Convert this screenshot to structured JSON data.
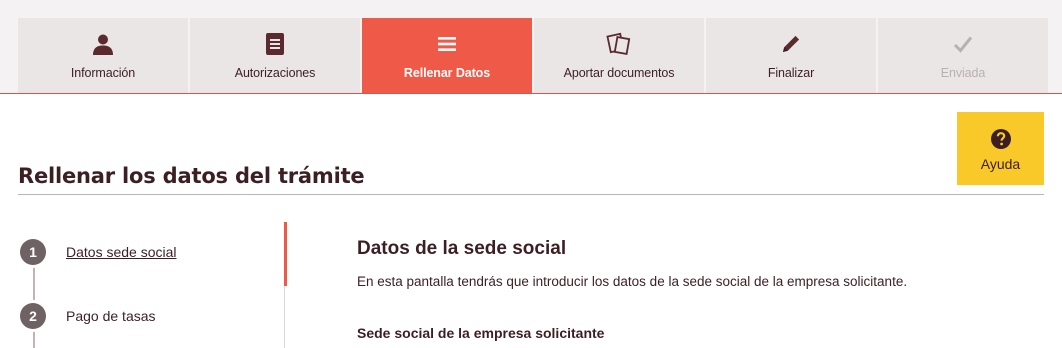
{
  "steps": [
    {
      "label": "Información",
      "icon": "user-icon",
      "state": "done"
    },
    {
      "label": "Autorizaciones",
      "icon": "document-icon",
      "state": "done"
    },
    {
      "label": "Rellenar Datos",
      "icon": "menu-lines-icon",
      "state": "active"
    },
    {
      "label": "Aportar documentos",
      "icon": "papers-icon",
      "state": "pending"
    },
    {
      "label": "Finalizar",
      "icon": "pencil-icon",
      "state": "pending"
    },
    {
      "label": "Enviada",
      "icon": "check-icon",
      "state": "disabled"
    }
  ],
  "help": {
    "label": "Ayuda",
    "icon": "question-circle-icon"
  },
  "page": {
    "title": "Rellenar los datos del trámite"
  },
  "substeps": [
    {
      "number": "1",
      "label": "Datos sede social",
      "current": true
    },
    {
      "number": "2",
      "label": "Pago de tasas",
      "current": false
    }
  ],
  "section": {
    "title": "Datos de la sede social",
    "description": "En esta pantalla tendrás que introducir los datos de la sede social de la empresa solicitante.",
    "subtitle": "Sede social de la empresa solicitante"
  },
  "colors": {
    "accent": "#ef5a48",
    "help": "#f9c929",
    "text": "#3b1f24",
    "tab_bg": "#ebe6e6",
    "disabled": "#b9b0b1"
  }
}
